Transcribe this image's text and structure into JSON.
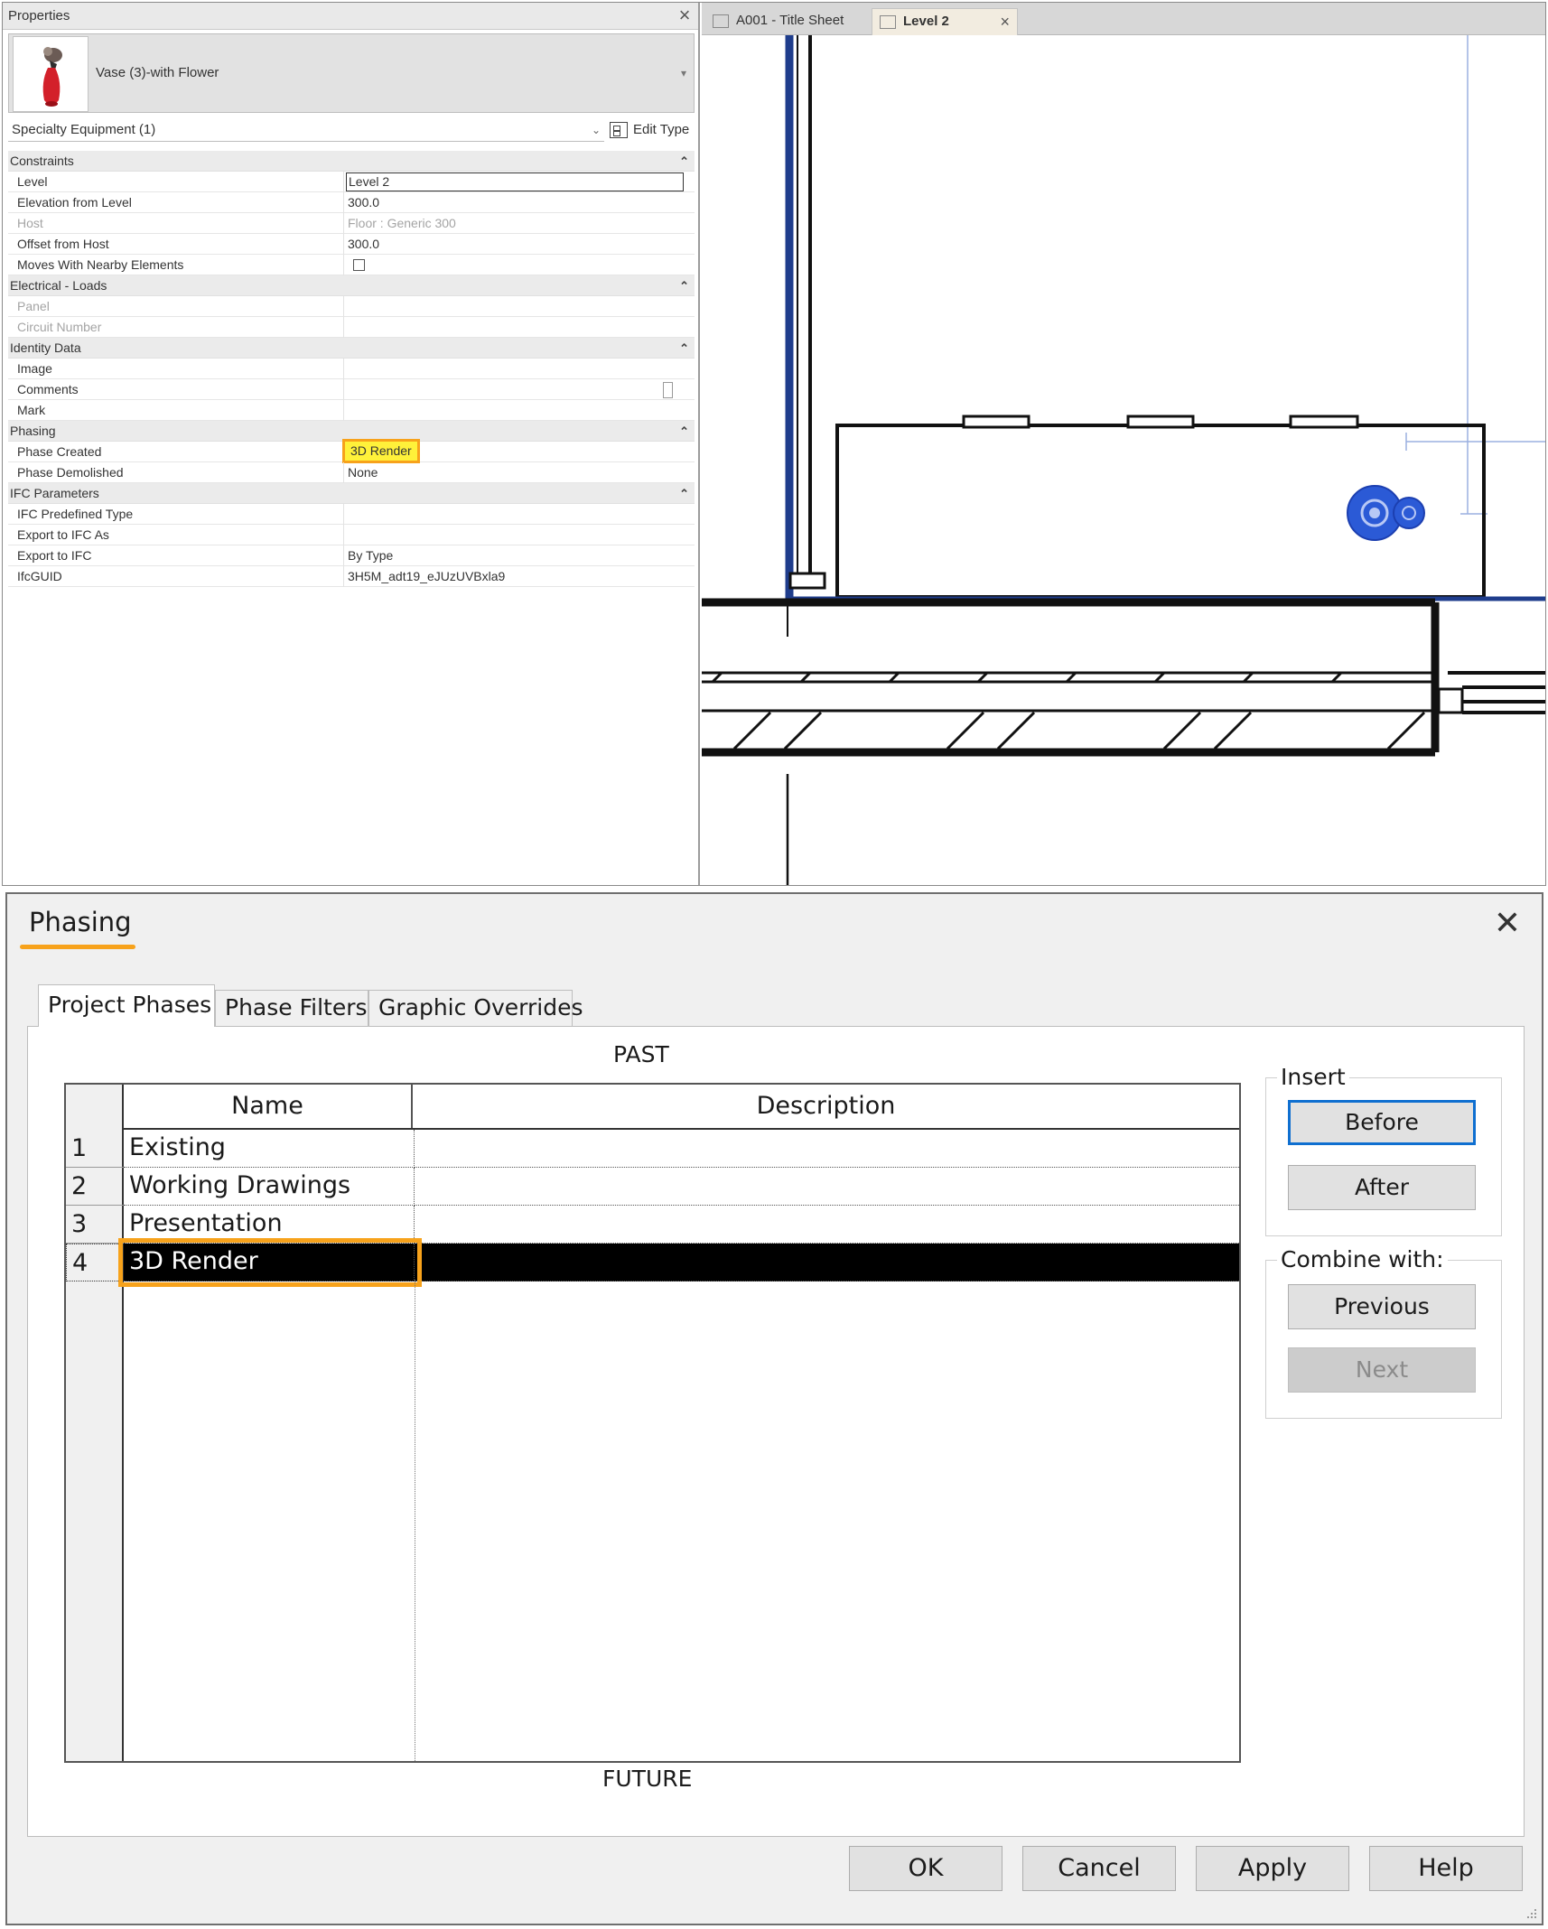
{
  "properties_panel": {
    "header": "Properties",
    "type_name": "Vase (3)-with Flower",
    "selector": "Specialty Equipment (1)",
    "edit_type_label": "Edit Type",
    "categories": {
      "constraints": "Constraints",
      "electrical": "Electrical - Loads",
      "identity": "Identity Data",
      "phasing": "Phasing",
      "ifc": "IFC Parameters"
    },
    "rows": {
      "level": {
        "name": "Level",
        "value": "Level 2"
      },
      "elevation": {
        "name": "Elevation from Level",
        "value": "300.0"
      },
      "host": {
        "name": "Host",
        "value": "Floor : Generic 300"
      },
      "offset": {
        "name": "Offset from Host",
        "value": "300.0"
      },
      "moves": {
        "name": "Moves With Nearby Elements",
        "value": ""
      },
      "panel": {
        "name": "Panel",
        "value": ""
      },
      "circuit": {
        "name": "Circuit Number",
        "value": ""
      },
      "image": {
        "name": "Image",
        "value": ""
      },
      "comments": {
        "name": "Comments",
        "value": ""
      },
      "mark": {
        "name": "Mark",
        "value": ""
      },
      "phase_created": {
        "name": "Phase Created",
        "value": "3D Render"
      },
      "phase_demolished": {
        "name": "Phase Demolished",
        "value": "None"
      },
      "ifc_predefined": {
        "name": "IFC Predefined Type",
        "value": ""
      },
      "export_ifc_as": {
        "name": "Export to IFC As",
        "value": ""
      },
      "export_ifc": {
        "name": "Export to IFC",
        "value": "By Type"
      },
      "ifcguid": {
        "name": "IfcGUID",
        "value": "3H5M_adt19_eJUzUVBxla9"
      }
    }
  },
  "view": {
    "tabs": [
      {
        "label": "A001 - Title Sheet"
      },
      {
        "label": "Level 2"
      }
    ]
  },
  "dialog": {
    "title": "Phasing",
    "tabs": [
      "Project Phases",
      "Phase Filters",
      "Graphic Overrides"
    ],
    "past_label": "PAST",
    "future_label": "FUTURE",
    "columns": {
      "name": "Name",
      "description": "Description"
    },
    "phases": [
      {
        "num": "1",
        "name": "Existing",
        "description": ""
      },
      {
        "num": "2",
        "name": "Working Drawings",
        "description": ""
      },
      {
        "num": "3",
        "name": "Presentation",
        "description": ""
      },
      {
        "num": "4",
        "name": "3D Render",
        "description": ""
      }
    ],
    "insert_group": {
      "label": "Insert",
      "before": "Before",
      "after": "After"
    },
    "combine_group": {
      "label": "Combine with:",
      "previous": "Previous",
      "next": "Next"
    },
    "buttons": {
      "ok": "OK",
      "cancel": "Cancel",
      "apply": "Apply",
      "help": "Help"
    }
  },
  "colors": {
    "highlight_outline": "#f7a21b",
    "highlight_fill": "#fff13a",
    "selection_blue": "#0f6fd0",
    "drawing_blue": "#1f3d8c"
  }
}
